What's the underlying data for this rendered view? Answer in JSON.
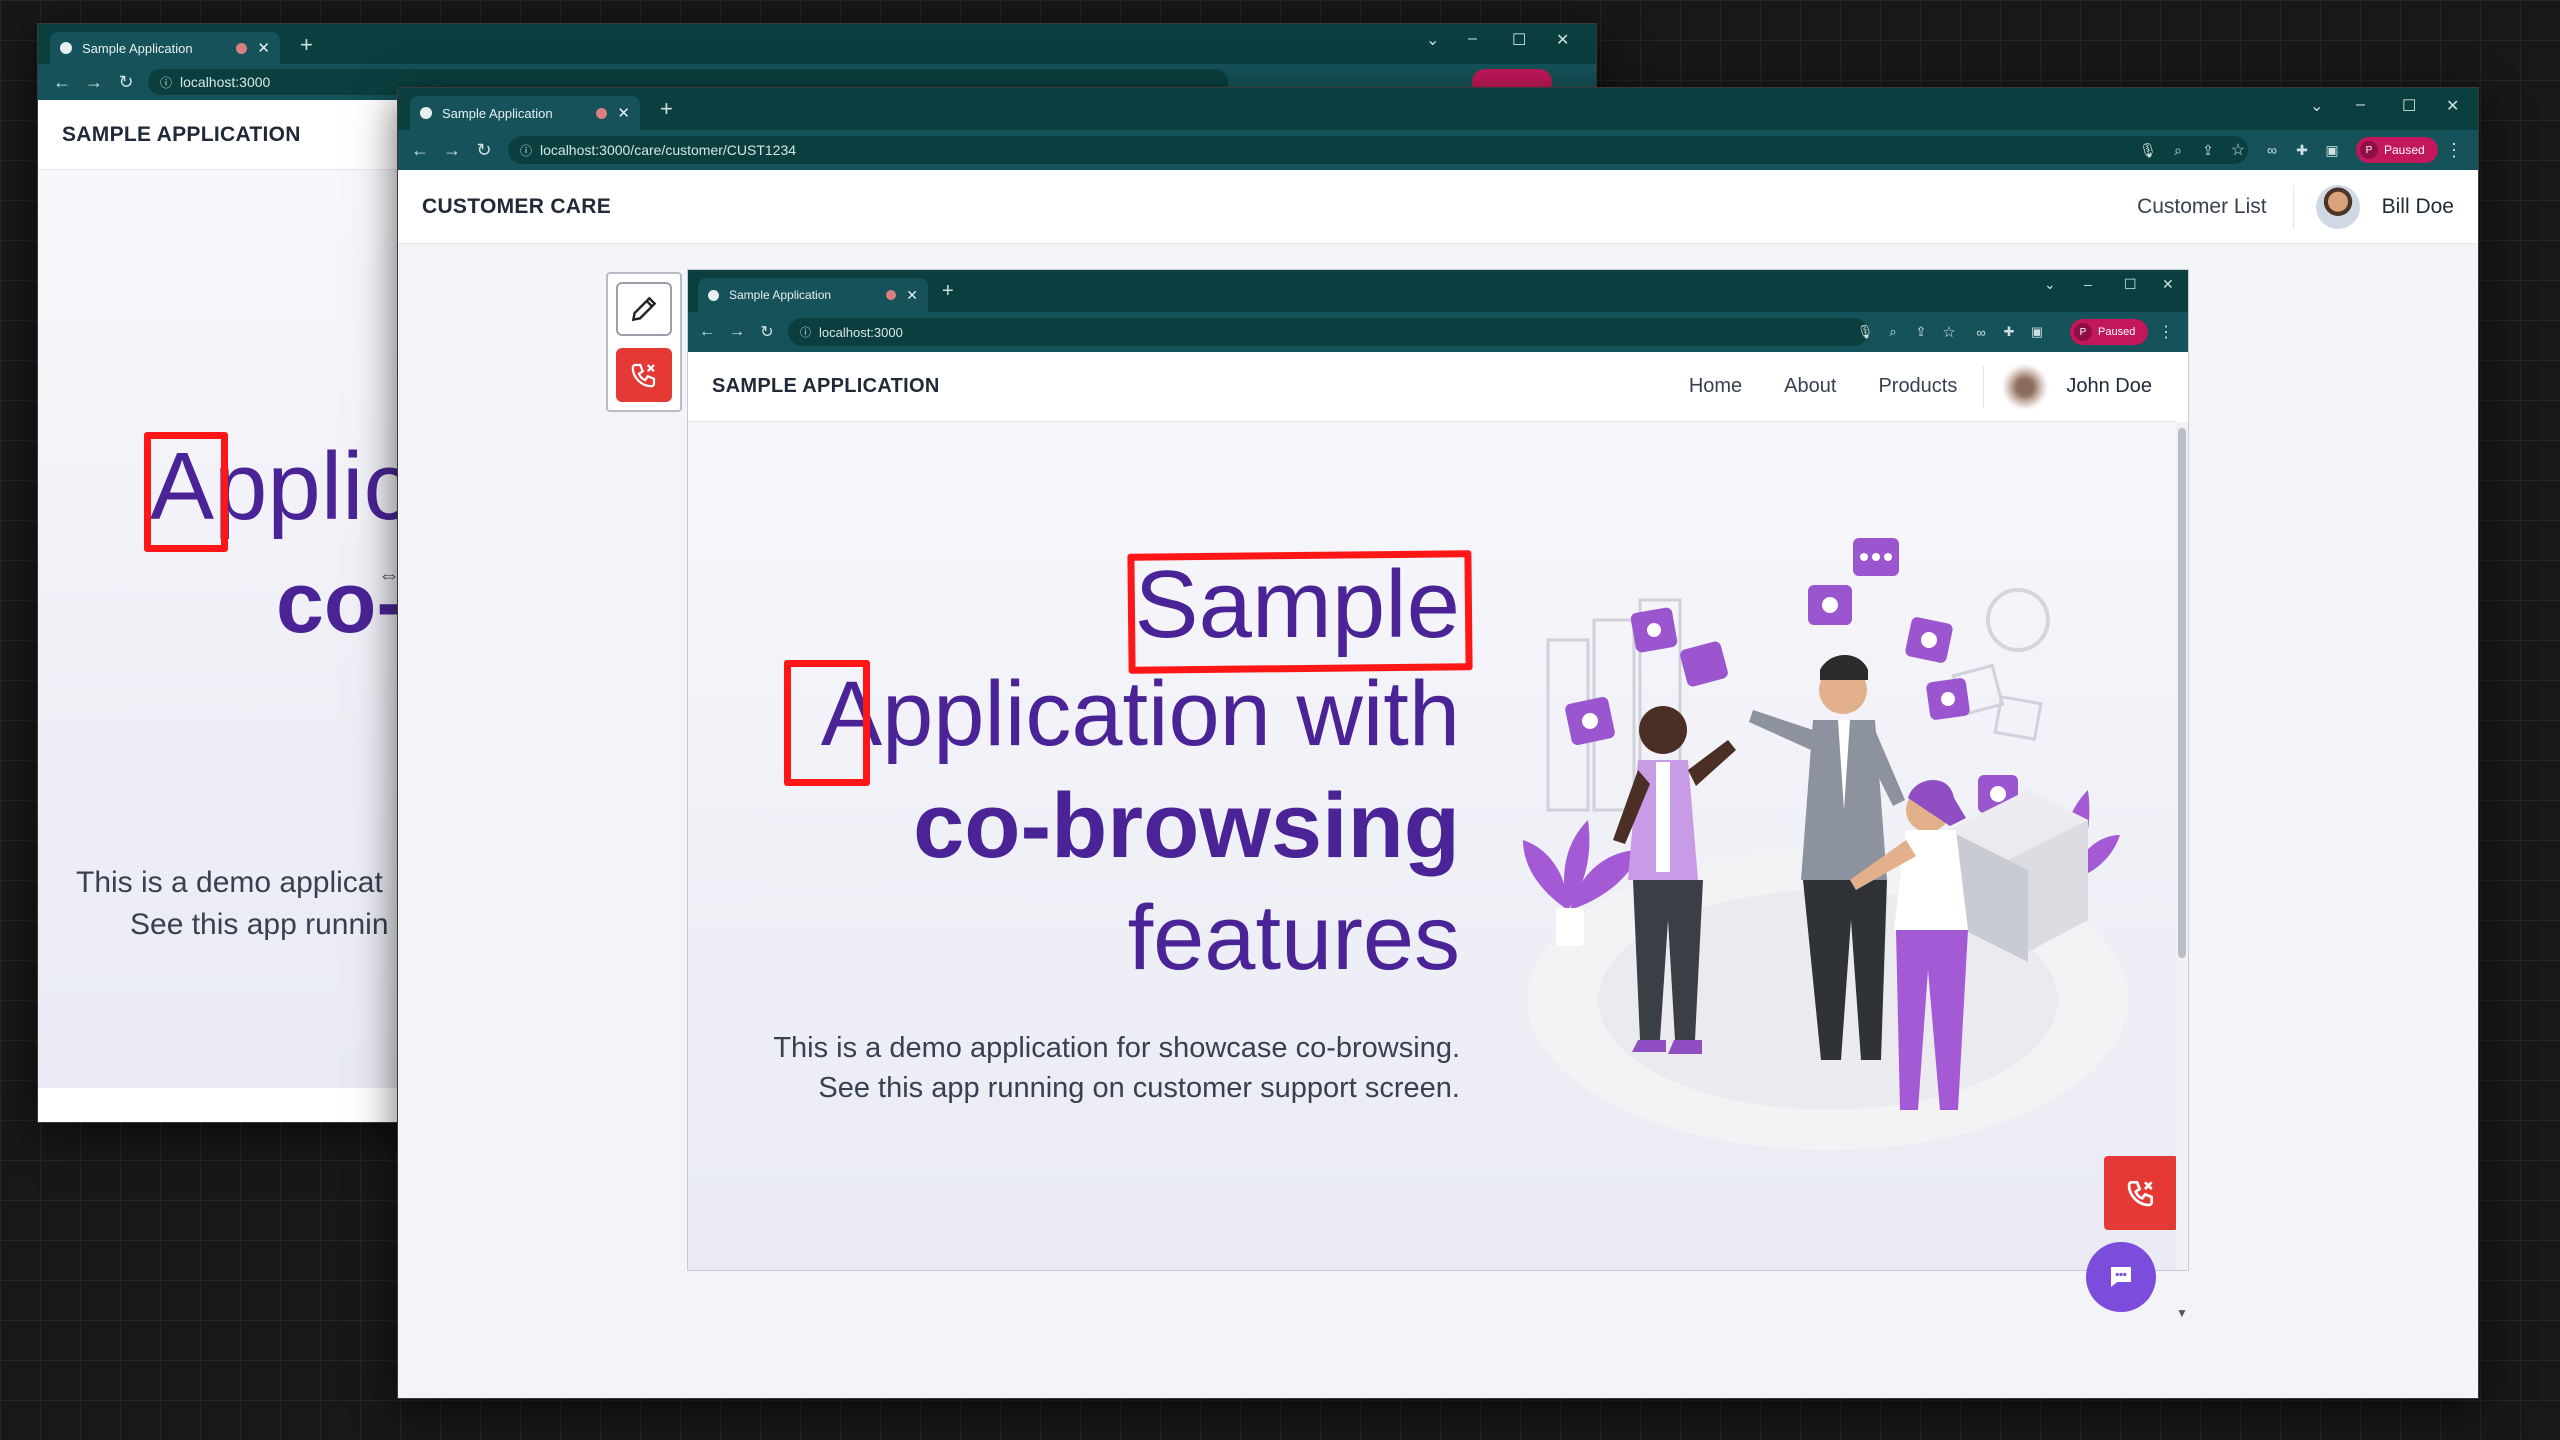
{
  "back_window": {
    "tab": {
      "title": "Sample Application"
    },
    "url": "localhost:3000",
    "header": {
      "brand": "SAMPLE APPLICATION"
    },
    "hero": {
      "line1": "Applic",
      "line2": "co-"
    },
    "desc": {
      "line1": "This is a demo applicat",
      "line2": "See this app runnin"
    }
  },
  "main_window": {
    "tab": {
      "title": "Sample Application"
    },
    "url": "localhost:3000/care/customer/CUST1234",
    "paused_label": "Paused",
    "profile_initial": "P",
    "header": {
      "brand": "CUSTOMER CARE",
      "nav_customer_list": "Customer List",
      "user_name": "Bill Doe"
    }
  },
  "inner_window": {
    "tab": {
      "title": "Sample Application"
    },
    "url": "localhost:3000",
    "paused_label": "Paused",
    "profile_initial": "P",
    "header": {
      "brand": "SAMPLE APPLICATION",
      "nav": [
        "Home",
        "About",
        "Products"
      ],
      "user_name": "John Doe"
    },
    "hero": {
      "line1": "Sample",
      "line2": "Application with",
      "line3": "co-browsing",
      "line4": "features"
    },
    "desc": {
      "line1": "This is a demo application for showcase co-browsing.",
      "line2": "See this app running on customer support screen."
    }
  },
  "colors": {
    "chrome_dark": "#0b3f3f",
    "chrome_tab": "#15525a",
    "brand_purple": "#4a2496",
    "annotation_red": "#ff1616",
    "end_call_red": "#e53935",
    "chat_purple": "#7c4ddc",
    "paused_pink": "#c2185b"
  },
  "icons": {
    "pen_tool": "pencil-icon",
    "end_call": "phone-hangup-icon",
    "chat": "chat-bubble-icon"
  }
}
